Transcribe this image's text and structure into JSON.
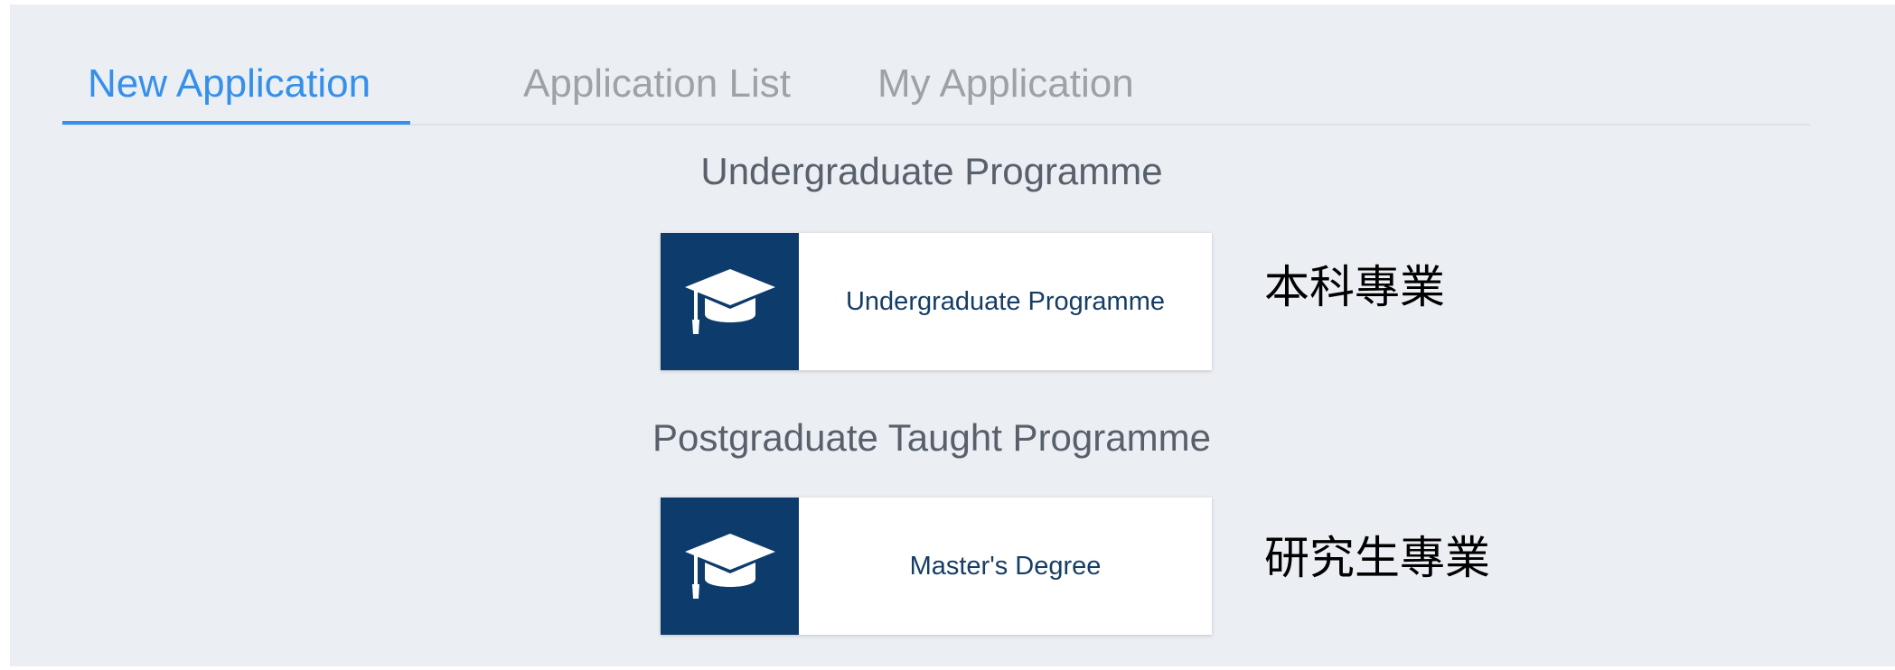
{
  "tabs": [
    {
      "label": "New Application",
      "active": true
    },
    {
      "label": "Application List",
      "active": false
    },
    {
      "label": "My Application",
      "active": false
    }
  ],
  "sections": [
    {
      "title": "Undergraduate Programme",
      "card_label": "Undergraduate Programme",
      "icon": "graduation-cap-icon",
      "note": "本科專業"
    },
    {
      "title": "Postgraduate Taught Programme",
      "card_label": "Master's Degree",
      "icon": "graduation-cap-icon",
      "note": "研究生專業"
    }
  ],
  "colors": {
    "accent": "#3590ea",
    "icon_background": "#0d3b6b",
    "panel_background": "#ebeef3",
    "inactive_tab": "#9ea2a8"
  }
}
